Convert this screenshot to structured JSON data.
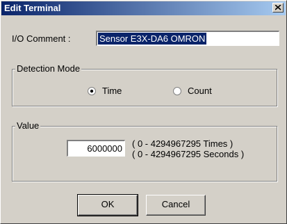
{
  "window": {
    "title": "Edit Terminal",
    "close_icon": "close-icon"
  },
  "io_comment": {
    "label": "I/O Comment :",
    "value": "Sensor E3X-DA6 OMRON"
  },
  "detection_mode": {
    "title": "Detection Mode",
    "options": [
      {
        "label": "Time",
        "selected": true
      },
      {
        "label": "Count",
        "selected": false
      }
    ]
  },
  "value_group": {
    "title": "Value",
    "value": "6000000",
    "range_times": "( 0 - 4294967295 Times )",
    "range_seconds": "( 0 - 4294967295 Seconds )"
  },
  "buttons": {
    "ok": "OK",
    "cancel": "Cancel"
  }
}
